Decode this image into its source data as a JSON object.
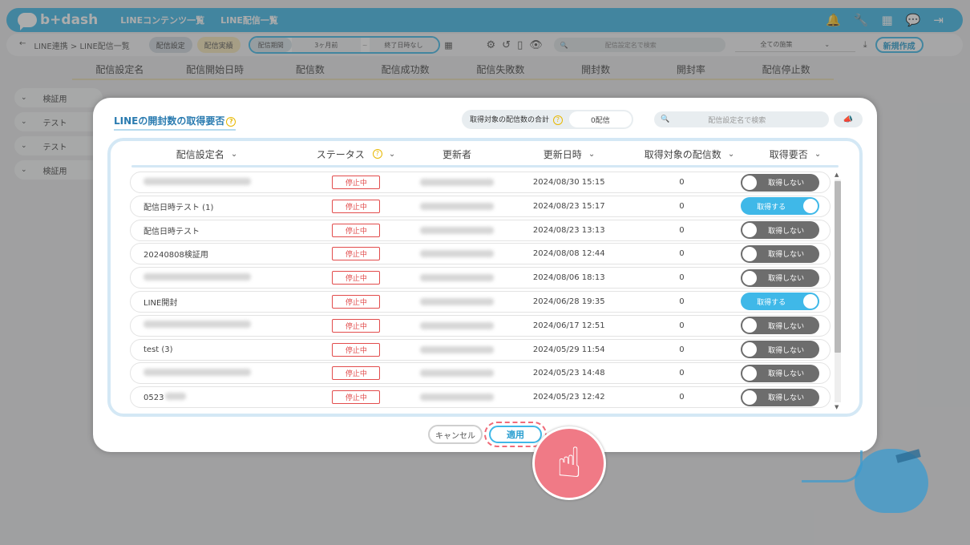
{
  "app": {
    "logo_text": "b+dash",
    "nav": [
      "LINEコンテンツ一覧",
      "LINE配信一覧"
    ],
    "top_icons": [
      "bell-icon",
      "wrench-icon",
      "grid-icon",
      "chat-icon",
      "logout-icon"
    ]
  },
  "subbar": {
    "back": "←",
    "breadcrumb": "LINE連携 > LINE配信一覧",
    "tab_settings": "配信設定",
    "tab_results": "配信実績",
    "period_label": "配信期間",
    "period_start": "3ヶ月前",
    "period_sep": "~",
    "period_end": "終了日時なし",
    "search_placeholder": "配信設定名で検索",
    "measure_select": "全ての施策",
    "new_button": "新規作成"
  },
  "bg_table": {
    "headers": [
      "配信設定名",
      "配信開始日時",
      "配信数",
      "配信成功数",
      "配信失敗数",
      "開封数",
      "開封率",
      "配信停止数"
    ],
    "rows": [
      "検証用",
      "テスト",
      "テスト",
      "検証用"
    ]
  },
  "modal": {
    "title": "LINEの開封数の取得要否",
    "total_label": "取得対象の配信数の合計",
    "total_value": "0配信",
    "search_placeholder": "配信設定名で検索",
    "headers": {
      "name": "配信設定名",
      "status": "ステータス",
      "updater": "更新者",
      "updated_at": "更新日時",
      "target_count": "取得対象の配信数",
      "fetch": "取得要否"
    },
    "rows": [
      {
        "name": "",
        "status": "停止中",
        "updated_at": "2024/08/30 15:15",
        "count": "0",
        "toggle": "取得しない",
        "on": false
      },
      {
        "name": "配信日時テスト (1)",
        "status": "停止中",
        "updated_at": "2024/08/23 15:17",
        "count": "0",
        "toggle": "取得する",
        "on": true
      },
      {
        "name": "配信日時テスト",
        "status": "停止中",
        "updated_at": "2024/08/23 13:13",
        "count": "0",
        "toggle": "取得しない",
        "on": false
      },
      {
        "name": "20240808検証用",
        "status": "停止中",
        "updated_at": "2024/08/08 12:44",
        "count": "0",
        "toggle": "取得しない",
        "on": false
      },
      {
        "name": "",
        "status": "停止中",
        "updated_at": "2024/08/06 18:13",
        "count": "0",
        "toggle": "取得しない",
        "on": false
      },
      {
        "name": "LINE開封",
        "status": "停止中",
        "updated_at": "2024/06/28 19:35",
        "count": "0",
        "toggle": "取得する",
        "on": true
      },
      {
        "name": "",
        "status": "停止中",
        "updated_at": "2024/06/17 12:51",
        "count": "0",
        "toggle": "取得しない",
        "on": false
      },
      {
        "name": "test (3)",
        "status": "停止中",
        "updated_at": "2024/05/29 11:54",
        "count": "0",
        "toggle": "取得しない",
        "on": false
      },
      {
        "name": "",
        "status": "停止中",
        "updated_at": "2024/05/23 14:48",
        "count": "0",
        "toggle": "取得しない",
        "on": false
      },
      {
        "name": "0523",
        "status": "停止中",
        "updated_at": "2024/05/23 12:42",
        "count": "0",
        "toggle": "取得しない",
        "on": false
      }
    ],
    "cancel_label": "キャンセル",
    "apply_label": "適用"
  },
  "colors": {
    "accent": "#3fb8e8",
    "status_red": "#e24c4c",
    "toggle_off": "#6d6d6d",
    "highlight_pink": "#f07a86"
  }
}
